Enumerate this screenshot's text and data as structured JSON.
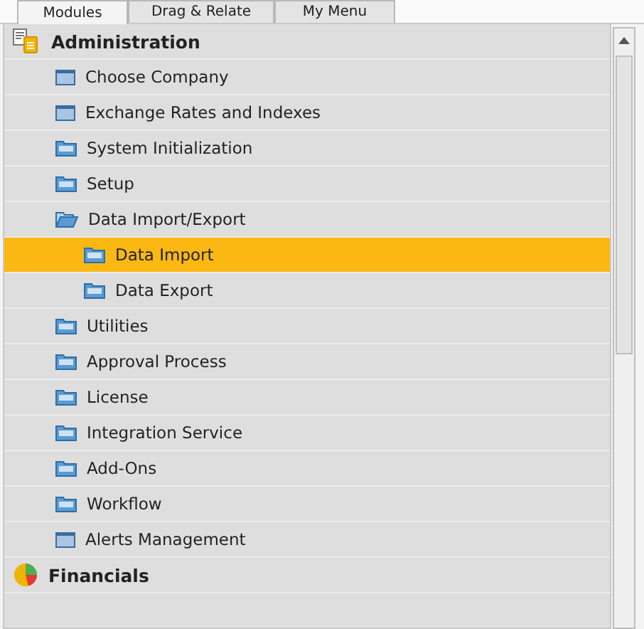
{
  "tabs": [
    {
      "label": "Modules",
      "selected": true
    },
    {
      "label": "Drag & Relate",
      "selected": false
    },
    {
      "label": "My Menu",
      "selected": false
    }
  ],
  "modules": [
    {
      "label": "Administration",
      "kind": "document",
      "expanded": true,
      "children": [
        {
          "label": "Choose Company",
          "kind": "window",
          "selected": false
        },
        {
          "label": "Exchange Rates and Indexes",
          "kind": "window",
          "selected": false
        },
        {
          "label": "System Initialization",
          "kind": "folder",
          "selected": false
        },
        {
          "label": "Setup",
          "kind": "folder",
          "selected": false
        },
        {
          "label": "Data Import/Export",
          "kind": "folder",
          "expanded": true,
          "selected": false,
          "children": [
            {
              "label": "Data Import",
              "kind": "folder",
              "selected": true
            },
            {
              "label": "Data Export",
              "kind": "folder",
              "selected": false
            }
          ]
        },
        {
          "label": "Utilities",
          "kind": "folder",
          "selected": false
        },
        {
          "label": "Approval Process",
          "kind": "folder",
          "selected": false
        },
        {
          "label": "License",
          "kind": "folder",
          "selected": false
        },
        {
          "label": "Integration Service",
          "kind": "folder",
          "selected": false
        },
        {
          "label": "Add-Ons",
          "kind": "folder",
          "selected": false
        },
        {
          "label": "Workflow",
          "kind": "folder",
          "selected": false
        },
        {
          "label": "Alerts Management",
          "kind": "window",
          "selected": false
        }
      ]
    },
    {
      "label": "Financials",
      "kind": "chart"
    }
  ]
}
